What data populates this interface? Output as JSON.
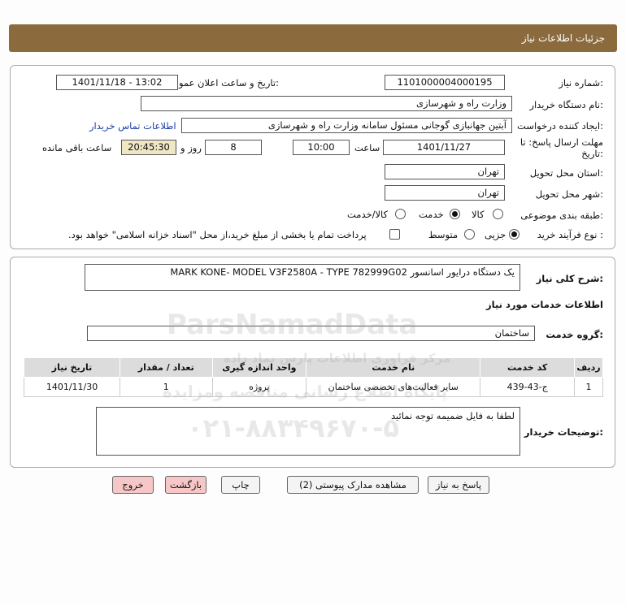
{
  "header": {
    "title": "جزئیات اطلاعات نیاز"
  },
  "form": {
    "need_number_label": "شماره نیاز:",
    "need_number": "1101000004000195",
    "announce_label": "تاریخ و ساعت اعلان عمومی:",
    "announce_value": "1401/11/18 - 13:02",
    "buyer_org_label": "نام دستگاه خریدار:",
    "buyer_org": "وزارت راه و شهرسازی",
    "requester_label": "ایجاد کننده درخواست:",
    "requester": "آبتین جهانبازی گوجانی مسئول سامانه وزارت راه و شهرسازی",
    "contact_link": "اطلاعات تماس خریدار",
    "deadline_label_1": "مهلت ارسال پاسخ: تا",
    "deadline_label_2": "تاریخ:",
    "deadline_date": "1401/11/27",
    "time_label": "ساعت",
    "deadline_time": "10:00",
    "days_value": "8",
    "days_label": "روز و",
    "remaining_time": "20:45:30",
    "remaining_label": "ساعت باقی مانده",
    "province_label": "استان محل تحویل:",
    "province": "تهران",
    "city_label": "شهر محل تحویل:",
    "city": "تهران",
    "category_label": "طبقه بندی موضوعی:",
    "category_options": [
      "کالا",
      "خدمت",
      "کالا/خدمت"
    ],
    "category_selected": "خدمت",
    "process_label": "نوع فرآیند خرید :",
    "process_options": [
      "جزیی",
      "متوسط"
    ],
    "process_selected": "جزیی",
    "payment_note": "پرداخت تمام یا بخشی از مبلغ خرید،از محل \"اسناد خزانه اسلامی\" خواهد بود."
  },
  "details": {
    "summary_label": "شرح کلی نیاز:",
    "summary": "یک دستگاه درایور اسانسور MARK KONE- MODEL V3F2580A - TYPE 782999G02",
    "services_title": "اطلاعات خدمات مورد نیاز",
    "service_group_label": "گروه خدمت:",
    "service_group": "ساختمان",
    "table": {
      "headers": [
        "ردیف",
        "کد خدمت",
        "نام خدمت",
        "واحد اندازه گیری",
        "تعداد / مقدار",
        "تاریخ نیاز"
      ],
      "rows": [
        [
          "1",
          "ج-43-439",
          "سایر فعالیت‌های تخصصی ساختمان",
          "پروژه",
          "1",
          "1401/11/30"
        ]
      ]
    },
    "buyer_notes_label": "توضیحات خریدار:",
    "buyer_notes": "لطفا به  فایل ضمیمه توجه نمائید"
  },
  "buttons": {
    "reply": "پاسخ به نیاز",
    "view_docs": "مشاهده مدارک پیوستی (2)",
    "print": "چاپ",
    "back": "بازگشت",
    "exit": "خروج"
  },
  "watermark": {
    "line1": "ParsNamadData",
    "line2": "مرکز فراوری اطلاعات پارس نماد داده",
    "line3": "پایگاه اطلاع رسانی مناقصه ومزایده",
    "phone": "۰۲۱-۸۸۳۴۹۶۷۰-۵"
  }
}
